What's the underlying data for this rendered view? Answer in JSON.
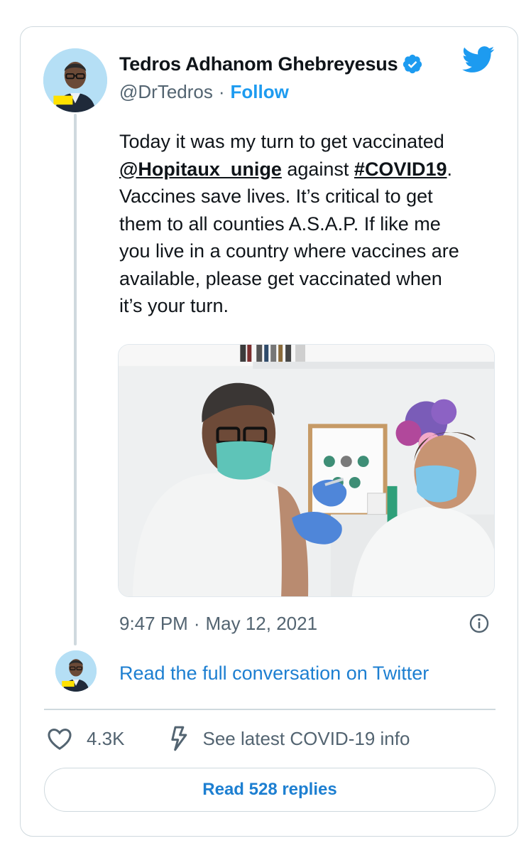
{
  "author": {
    "display_name": "Tedros Adhanom Ghebreyesus",
    "handle": "@DrTedros",
    "separator": "·",
    "follow_label": "Follow",
    "verified": true,
    "avatar_badge_text": "I support #HealthForAll"
  },
  "tweet": {
    "lines": [
      {
        "parts": [
          {
            "text": "Today it was my turn to get vaccinated",
            "kind": "text"
          }
        ]
      },
      {
        "parts": [
          {
            "text": "@Hopitaux_unige",
            "kind": "mention"
          },
          {
            "text": " against ",
            "kind": "text"
          },
          {
            "text": "#COVID19",
            "kind": "hashtag"
          },
          {
            "text": ".",
            "kind": "text"
          }
        ]
      },
      {
        "parts": [
          {
            "text": "Vaccines save lives. It’s critical to get",
            "kind": "text"
          }
        ]
      },
      {
        "parts": [
          {
            "text": "them to all counties A.S.A.P. If like me",
            "kind": "text"
          }
        ]
      },
      {
        "parts": [
          {
            "text": "you live in a country where vaccines are",
            "kind": "text"
          }
        ]
      },
      {
        "parts": [
          {
            "text": "available, please get vaccinated when",
            "kind": "text"
          }
        ]
      },
      {
        "parts": [
          {
            "text": "it’s your turn.",
            "kind": "text"
          }
        ]
      }
    ],
    "photo_alt": "Tedros receiving a vaccination from a healthcare worker",
    "time": "9:47 PM",
    "date_separator": "·",
    "date": "May 12, 2021"
  },
  "conversation": {
    "read_full_label": "Read the full conversation on Twitter"
  },
  "actions": {
    "like_count": "4.3K",
    "covid_info_label": "See latest COVID-19 info",
    "read_replies_label": "Read 528 replies"
  },
  "icons": {
    "brand": "twitter-bird-icon",
    "verified": "verified-badge-icon",
    "info": "info-circle-icon",
    "like": "heart-icon",
    "covid": "lightning-bolt-icon"
  },
  "colors": {
    "link_blue": "#1d9bf0",
    "text": "#0f1419",
    "muted": "#536471",
    "border": "#cfd9de"
  }
}
